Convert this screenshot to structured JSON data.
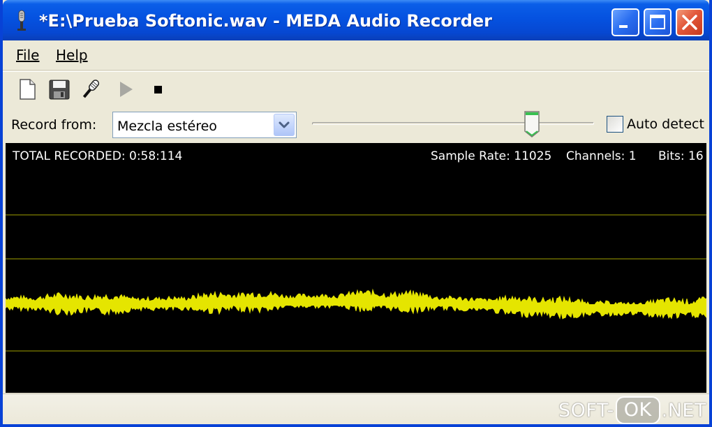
{
  "window": {
    "title": "*E:\\Prueba Softonic.wav - MEDA Audio Recorder",
    "icon": "microphone-icon",
    "controls": [
      "minimize-icon",
      "maximize-icon",
      "close-icon"
    ]
  },
  "menu": {
    "file": "File",
    "help": "Help"
  },
  "toolbar": {
    "buttons": [
      "new-file-icon",
      "save-icon",
      "microphone-icon",
      "play-icon",
      "stop-icon"
    ]
  },
  "record": {
    "label": "Record from:",
    "source": "Mezcla estéreo",
    "level_fraction": 0.78,
    "auto_detect_label": "Auto detect",
    "auto_detect_checked": false
  },
  "scope": {
    "total_recorded": "TOTAL RECORDED: 0:58:114",
    "sample_rate": "Sample Rate: 11025",
    "channels": "Channels: 1",
    "bits": "Bits: 16",
    "background": "#000000",
    "gridline_color": "#6b6b00",
    "wave_color": "#e5e500"
  },
  "watermark": {
    "left": "SOFT-",
    "middle": "OK",
    "right": ".NET"
  },
  "colors": {
    "titlebar": "#0552e0",
    "face": "#ece9d8"
  }
}
